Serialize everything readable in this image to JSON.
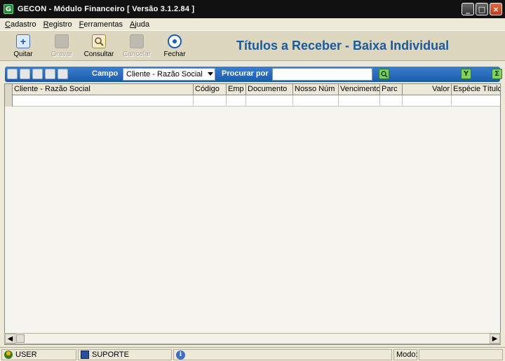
{
  "window": {
    "title": "GECON  -  Módulo Financeiro    [ Versão 3.1.2.84 ]",
    "app_icon": "G",
    "minimize": "_",
    "maximize": "□",
    "close": "×"
  },
  "menu": [
    "Cadastro",
    "Registro",
    "Ferramentas",
    "Ajuda"
  ],
  "toolbar": {
    "buttons": [
      {
        "label": "Quitar",
        "icon": "add-icon",
        "enabled": true
      },
      {
        "label": "Gravar",
        "icon": "save-icon",
        "enabled": false
      },
      {
        "label": "Consultar",
        "icon": "search-icon",
        "enabled": true
      },
      {
        "label": "Cancelar",
        "icon": "cancel-icon",
        "enabled": false
      },
      {
        "label": "Fechar",
        "icon": "close-icon",
        "enabled": true
      }
    ],
    "form_title": "Títulos a Receber - Baixa Individual"
  },
  "search": {
    "campo_label": "Campo",
    "campo_value": "Cliente - Razão Social",
    "procurar_label": "Procurar por",
    "query": "",
    "filter_icon": "Y",
    "sum_icon": "Σ"
  },
  "grid": {
    "columns": [
      "Cliente - Razão Social",
      "Código",
      "Emp",
      "Documento",
      "Nosso Núm",
      "Vencimento",
      "Parc",
      "Valor",
      "Espécie Título"
    ],
    "rows": []
  },
  "colors": {
    "title_bar": "#111111",
    "accent_blue": "#1c5aa8",
    "form_title": "#1a5a9e"
  },
  "status": {
    "user": "USER",
    "support": "SUPORTE",
    "mode_label": "Modo:",
    "mode_value": ""
  }
}
